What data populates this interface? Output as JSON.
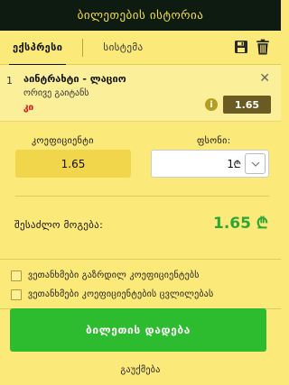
{
  "header": {
    "title": "ბილეთების ისტორია"
  },
  "tabs": [
    {
      "label": "ექსპრესი",
      "active": true
    },
    {
      "label": "სისტემა",
      "active": false
    }
  ],
  "toolbar": {
    "save_icon": "floppy-disk-icon",
    "delete_icon": "trash-icon"
  },
  "bet": {
    "index": "1",
    "match": "აინტრახტი - ლაციო",
    "pick": "ორივე გაიტანს",
    "result": "კი",
    "odds": "1.65"
  },
  "stake": {
    "coef_label": "კოეფიციენტი",
    "coef_value": "1.65",
    "money_label": "ფსონი:",
    "money_value": "1",
    "currency": "₾"
  },
  "winnings": {
    "label": "შესაძლო მოგება:",
    "value": "1.65 ₾"
  },
  "options": [
    "ვეთანხმები გაზრდილ კოეფიციენტებს",
    "ვეთანხმები კოეფიციენტების ცვლილებას"
  ],
  "actions": {
    "place_bet": "ბილეთის დადება",
    "cancel": "გაუქმება"
  },
  "colors": {
    "header_bg": "#0d1b10",
    "header_text": "#f5e04a",
    "panel_bg": "#fbe97a",
    "place_button": "#2dbb2f",
    "win_value": "#2da636",
    "odds_badge": "#6a5b22"
  }
}
